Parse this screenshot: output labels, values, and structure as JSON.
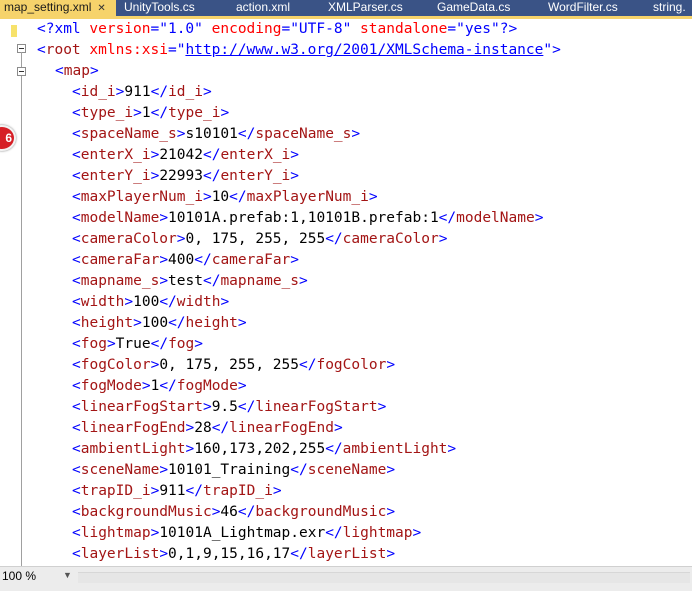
{
  "tabs": [
    {
      "label": "map_setting.xml",
      "active": true
    },
    {
      "label": "UnityTools.cs",
      "active": false
    },
    {
      "label": "action.xml",
      "active": false
    },
    {
      "label": "XMLParser.cs",
      "active": false
    },
    {
      "label": "GameData.cs",
      "active": false
    },
    {
      "label": "WordFilter.cs",
      "active": false
    },
    {
      "label": "string.",
      "active": false
    }
  ],
  "badge": {
    "text": "6"
  },
  "editor": {
    "decl": {
      "open": "<?xml",
      "a1": "version",
      "v1": "\"1.0\"",
      "a2": "encoding",
      "v2": "\"UTF-8\"",
      "a3": "standalone",
      "v3": "\"yes\"",
      "close": "?>"
    },
    "root": {
      "tag": "root",
      "attr": "xmlns:xsi",
      "eq": "=\"",
      "link": "http://www.w3.org/2001/XMLSchema-instance",
      "endq": "\">"
    },
    "map_tag": "map",
    "elements": [
      {
        "tag": "id_i",
        "value": "911"
      },
      {
        "tag": "type_i",
        "value": "1"
      },
      {
        "tag": "spaceName_s",
        "value": "s10101"
      },
      {
        "tag": "enterX_i",
        "value": "21042"
      },
      {
        "tag": "enterY_i",
        "value": "22993"
      },
      {
        "tag": "maxPlayerNum_i",
        "value": "10"
      },
      {
        "tag": "modelName",
        "value": "10101A.prefab:1,10101B.prefab:1"
      },
      {
        "tag": "cameraColor",
        "value": "0, 175, 255, 255"
      },
      {
        "tag": "cameraFar",
        "value": "400"
      },
      {
        "tag": "mapname_s",
        "value": "test"
      },
      {
        "tag": "width",
        "value": "100"
      },
      {
        "tag": "height",
        "value": "100"
      },
      {
        "tag": "fog",
        "value": "True"
      },
      {
        "tag": "fogColor",
        "value": "0, 175, 255, 255"
      },
      {
        "tag": "fogMode",
        "value": "1"
      },
      {
        "tag": "linearFogStart",
        "value": "9.5"
      },
      {
        "tag": "linearFogEnd",
        "value": "28"
      },
      {
        "tag": "ambientLight",
        "value": "160,173,202,255"
      },
      {
        "tag": "sceneName",
        "value": "10101_Training"
      },
      {
        "tag": "trapID_i",
        "value": "911"
      },
      {
        "tag": "backgroundMusic",
        "value": "46"
      },
      {
        "tag": "lightmap",
        "value": "10101A_Lightmap.exr"
      },
      {
        "tag": "layerList",
        "value": "0,1,9,15,16,17"
      }
    ]
  },
  "status": {
    "zoom": "100 %"
  },
  "colors": {
    "tab_strip": "#3a5386",
    "active_tab": "#f6d36b",
    "xml_tag": "#a31515",
    "xml_bracket": "#0000ff",
    "xml_attr": "#ff0000"
  }
}
